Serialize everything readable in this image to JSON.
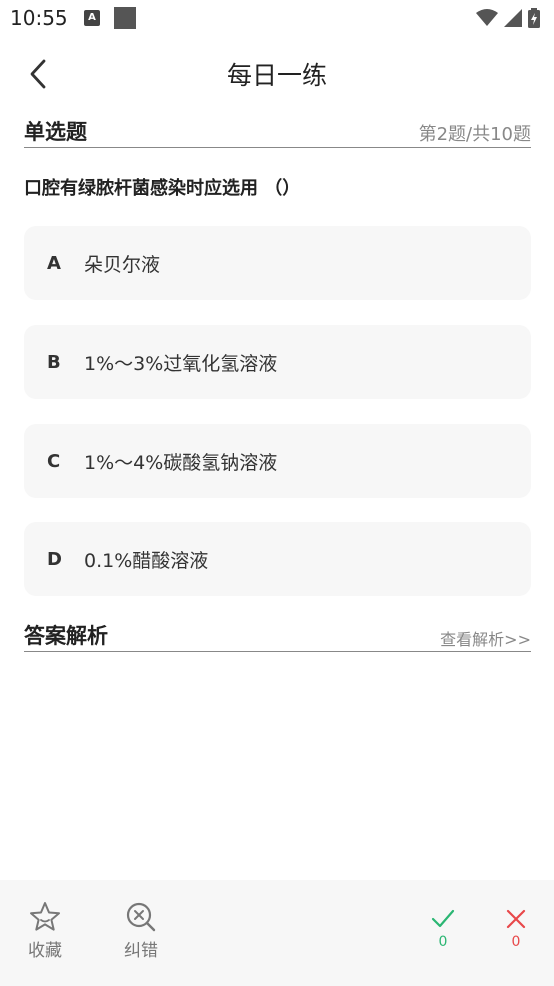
{
  "status_bar": {
    "time": "10:55",
    "notif_icon_letter": "A"
  },
  "header": {
    "title": "每日一练"
  },
  "question_section": {
    "title": "单选题",
    "progress": "第2题/共10题"
  },
  "question": {
    "text": "口腔有绿脓杆菌感染时应选用 （）"
  },
  "options": [
    {
      "letter": "A",
      "text": "朵贝尔液"
    },
    {
      "letter": "B",
      "text": "1%～3%过氧化氢溶液"
    },
    {
      "letter": "C",
      "text": "1%～4%碳酸氢钠溶液"
    },
    {
      "letter": "D",
      "text": "0.1%醋酸溶液"
    }
  ],
  "answer_section": {
    "title": "答案解析",
    "link": "查看解析>>"
  },
  "bottom_bar": {
    "favorite_label": "收藏",
    "correct_error_label": "纠错",
    "correct_count": "0",
    "wrong_count": "0"
  },
  "colors": {
    "correct": "#2bb673",
    "wrong": "#e8484a",
    "option_bg": "#f7f7f7",
    "bar_bg": "#f7f7f7"
  }
}
